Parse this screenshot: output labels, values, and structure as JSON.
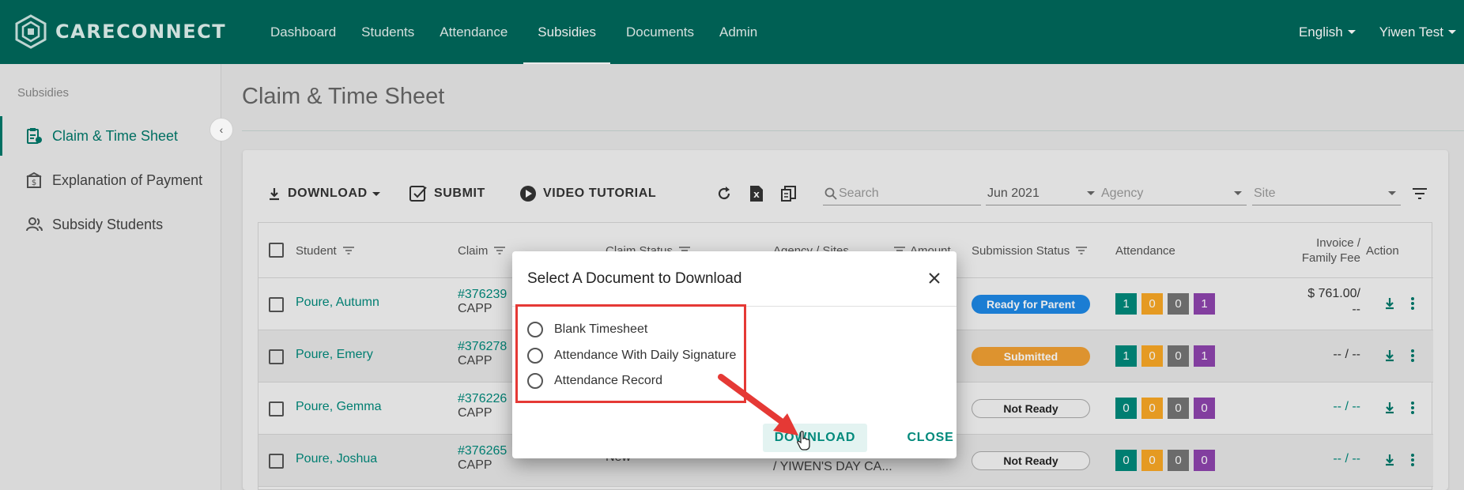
{
  "app": {
    "brand": "CARECONNECT"
  },
  "nav": {
    "items": [
      "Dashboard",
      "Students",
      "Attendance",
      "Subsidies",
      "Documents",
      "Admin"
    ],
    "active": "Subsidies",
    "language": "English",
    "user": "Yiwen Test"
  },
  "sidebar": {
    "header": "Subsidies",
    "items": [
      {
        "label": "Claim & Time Sheet",
        "icon": "clipboard-icon",
        "active": true
      },
      {
        "label": "Explanation of Payment",
        "icon": "building-dollar-icon",
        "active": false
      },
      {
        "label": "Subsidy Students",
        "icon": "users-icon",
        "active": false
      }
    ]
  },
  "page": {
    "title": "Claim & Time Sheet"
  },
  "toolbar": {
    "download": "DOWNLOAD",
    "submit": "SUBMIT",
    "video": "VIDEO TUTORIAL",
    "search_placeholder": "Search",
    "month": "Jun 2021",
    "agency_placeholder": "Agency",
    "site_placeholder": "Site"
  },
  "table": {
    "headers": {
      "student": "Student",
      "claim": "Claim",
      "claim_status": "Claim Status",
      "agency_sites": "Agency / Sites",
      "amount": "Amount",
      "submission_status": "Submission Status",
      "attendance": "Attendance",
      "invoice_line1": "Invoice /",
      "invoice_line2": "Family Fee",
      "action": "Action"
    },
    "rows": [
      {
        "student": "Poure, Autumn",
        "claim": "#376239",
        "program": "CAPP",
        "status": "Ready for Parent",
        "attendance": [
          "1",
          "0",
          "0",
          "1"
        ],
        "invoice": "$ 761.00/",
        "invoice2": "--"
      },
      {
        "student": "Poure, Emery",
        "claim": "#376278",
        "program": "CAPP",
        "status": "Submitted",
        "attendance": [
          "1",
          "0",
          "0",
          "1"
        ],
        "invoice": "-- / --",
        "invoice2": ""
      },
      {
        "student": "Poure, Gemma",
        "claim": "#376226",
        "program": "CAPP",
        "status": "Not Ready",
        "attendance": [
          "0",
          "0",
          "0",
          "0"
        ],
        "invoice": "-- / --",
        "invoice2": ""
      },
      {
        "student": "Poure, Joshua",
        "claim": "#376265",
        "program": "CAPP",
        "status": "Not Ready",
        "attendance": [
          "0",
          "0",
          "0",
          "0"
        ],
        "invoice": "-- / --",
        "invoice2": "",
        "claim_status": "New",
        "agency": "/ YIWEN'S DAY CA...",
        "amount": "--"
      }
    ]
  },
  "colors": {
    "primary": "#00695c",
    "link": "#00897b",
    "ready": "#1e88e5",
    "submitted": "#f0a033",
    "att_green": "#00897b",
    "att_yellow": "#f9a825",
    "att_gray": "#757575",
    "att_purple": "#8e44ad",
    "highlight": "#e53935"
  },
  "dialog": {
    "title": "Select A Document to Download",
    "options": [
      "Blank Timesheet",
      "Attendance With Daily Signature",
      "Attendance Record"
    ],
    "download_label": "DOWNLOAD",
    "close_label": "CLOSE"
  }
}
